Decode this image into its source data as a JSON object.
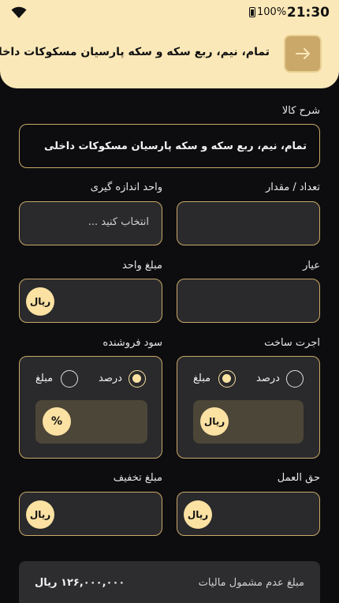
{
  "status_bar": {
    "battery": "100%",
    "time": "21:30",
    "wifi_icon": "wifi-icon",
    "battery_icon": "battery-icon"
  },
  "header": {
    "title": "تمام، نیم، ربع سکه و سکه پارسیان مسکوکات داخلی",
    "back_icon": "arrow-right-icon"
  },
  "form": {
    "description": {
      "label": "شرح کالا",
      "value": "تمام، نیم، ربع سکه و سکه پارسیان مسکوکات داخلی"
    },
    "quantity": {
      "label": "تعداد /  مقدار",
      "value": ""
    },
    "unit": {
      "label": "واحد اندازه گیری",
      "placeholder": "انتخاب کنید ..."
    },
    "purity": {
      "label": "عیار",
      "value": ""
    },
    "unit_price": {
      "label": "مبلغ واحد",
      "currency": "ریال"
    },
    "wage": {
      "label": "اجرت ساخت",
      "option_percent": "درصد",
      "option_amount": "مبلغ",
      "selected": "amount",
      "currency": "ریال"
    },
    "seller_profit": {
      "label": "سود فروشنده",
      "option_percent": "درصد",
      "option_amount": "مبلغ",
      "selected": "percent",
      "unit": "%"
    },
    "commission": {
      "label": "حق العمل",
      "currency": "ریال"
    },
    "discount": {
      "label": "مبلغ تخفیف",
      "currency": "ریال"
    }
  },
  "summary": {
    "label": "مبلغ عدم مشمول مالیات",
    "value": "۱۲۶,۰۰۰,۰۰۰ ریال"
  },
  "colors": {
    "accent": "#fbe1a2",
    "header_bg": "#fbe8b8",
    "border": "#c9a869",
    "bg": "#0d0d0f",
    "field_bg": "#2a2a2c"
  }
}
